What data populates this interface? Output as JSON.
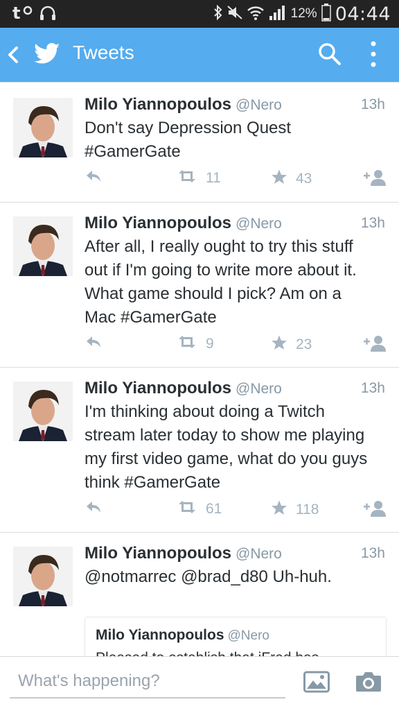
{
  "status_bar": {
    "battery_percent": "12%",
    "time": "04:44",
    "icons": [
      "tango-icon",
      "headphones-icon",
      "bluetooth-icon",
      "mute-icon",
      "wifi-icon",
      "signal-icon",
      "battery-icon"
    ]
  },
  "app_bar": {
    "title": "Tweets",
    "icons": [
      "back-arrow-icon",
      "twitter-bird-icon",
      "search-icon",
      "more-vert-icon"
    ]
  },
  "colors": {
    "app_bar": "#55acee",
    "status_bar": "#232323",
    "muted_text": "#8899a6",
    "action_icons": "#a5b4c0"
  },
  "tweets": [
    {
      "name": "Milo Yiannopoulos",
      "handle": "@Nero",
      "time": "13h",
      "text": "Don't say Depression Quest\n#GamerGate",
      "retweets": "11",
      "favorites": "43"
    },
    {
      "name": "Milo Yiannopoulos",
      "handle": "@Nero",
      "time": "13h",
      "text": "After all, I really ought to try this stuff\nout if I'm going to write more about it.\nWhat game should I pick? Am on a\nMac #GamerGate",
      "retweets": "9",
      "favorites": "23"
    },
    {
      "name": "Milo Yiannopoulos",
      "handle": "@Nero",
      "time": "13h",
      "text": "I'm thinking about doing a Twitch\nstream later today to show me playing\nmy first video game, what do you guys\nthink #GamerGate",
      "retweets": "61",
      "favorites": "118"
    },
    {
      "name": "Milo Yiannopoulos",
      "handle": "@Nero",
      "time": "13h",
      "text": "@notmarrec @brad_d80 Uh-huh.",
      "quoted": {
        "name": "Milo Yiannopoulos",
        "handle": "@Nero",
        "text": "Pleased to establish that iFred has\nindeed been getting some money"
      }
    }
  ],
  "composer": {
    "placeholder": "What's happening?",
    "value": "",
    "icons": [
      "photo-icon",
      "camera-icon"
    ]
  }
}
